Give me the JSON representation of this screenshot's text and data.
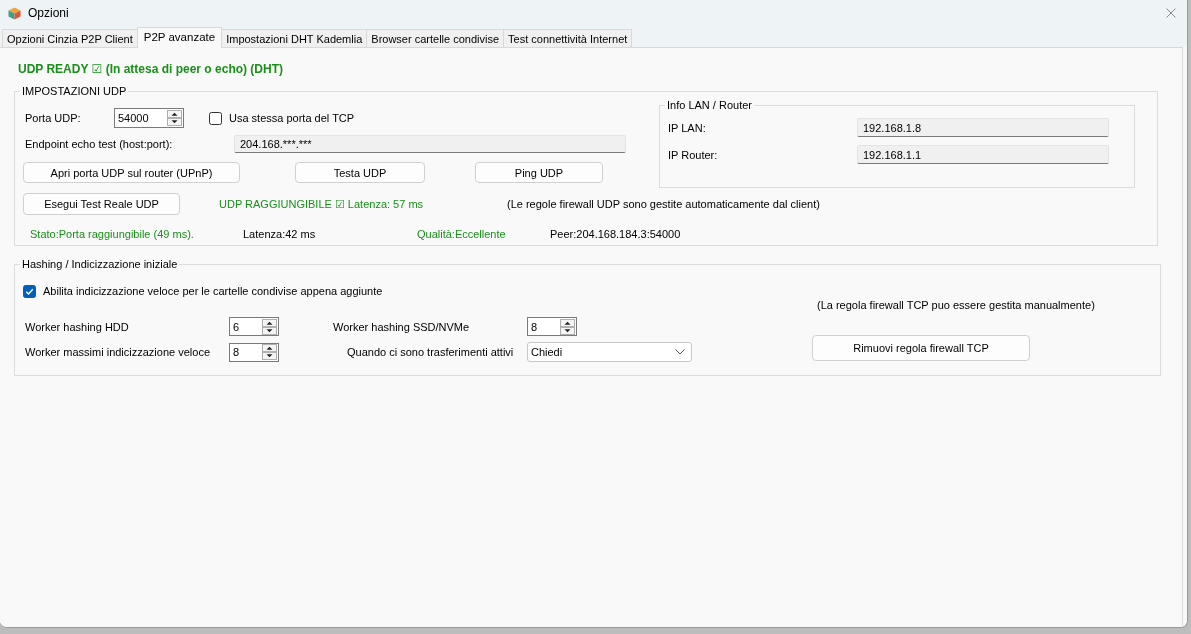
{
  "window": {
    "title": "Opzioni"
  },
  "tabs": [
    {
      "label": "Opzioni Cinzia P2P Client",
      "selected": false
    },
    {
      "label": "P2P avanzate",
      "selected": true
    },
    {
      "label": "Impostazioni DHT Kademlia",
      "selected": false
    },
    {
      "label": "Browser cartelle condivise",
      "selected": false
    },
    {
      "label": "Test connettività Internet",
      "selected": false
    }
  ],
  "status_banner": "UDP READY ☑ (In attesa di peer o echo) (DHT)",
  "udp_settings": {
    "title": "IMPOSTAZIONI UDP",
    "port": {
      "label": "Porta UDP:",
      "value": "54000"
    },
    "same_port": {
      "label": "Usa stessa porta del TCP",
      "checked": false
    },
    "echo_endpoint": {
      "label": "Endpoint echo test (host:port):",
      "value": "204.168.***.***"
    },
    "buttons": [
      "Apri porta UDP sul router (UPnP)",
      "Testa UDP",
      "Ping UDP"
    ],
    "lan_info": {
      "title": "Info LAN / Router",
      "rows": [
        {
          "label": "IP LAN:",
          "value": "192.168.1.8"
        },
        {
          "label": "IP Router:",
          "value": "192.168.1.1"
        }
      ]
    },
    "real_test_button": "Esegui Test Reale UDP",
    "reachability": "UDP RAGGIUNGIBILE ☑ Latenza: 57 ms",
    "firewall_note": "(Le regole firewall UDP sono gestite automaticamente dal client)",
    "results": [
      {
        "text": "Stato:Porta raggiungibile (49 ms).",
        "color": "#1a8f1a"
      },
      {
        "text": "Latenza:42 ms",
        "color": "#000000"
      },
      {
        "text": "Qualità:Eccellente",
        "color": "#1a8f1a"
      },
      {
        "text": "Peer:204.168.184.3:54000",
        "color": "#000000"
      }
    ]
  },
  "hashing": {
    "title": "Hashing / Indicizzazione iniziale",
    "fast_indexing": {
      "label": "Abilita indicizzazione veloce per le cartelle condivise appena aggiunte",
      "checked": true
    },
    "tcp_note": "(La regola firewall TCP puo essere gestita manualmente)",
    "hdd_workers": {
      "label": "Worker hashing HDD",
      "value": "6"
    },
    "ssd_workers": {
      "label": "Worker hashing SSD/NVMe",
      "value": "8"
    },
    "max_fast_workers": {
      "label": "Worker massimi indicizzazione veloce",
      "value": "8"
    },
    "active_transfers": {
      "label": "Quando ci sono trasferimenti attivi",
      "value": "Chiedi"
    },
    "remove_rule_button": "Rimuovi regola firewall TCP"
  }
}
